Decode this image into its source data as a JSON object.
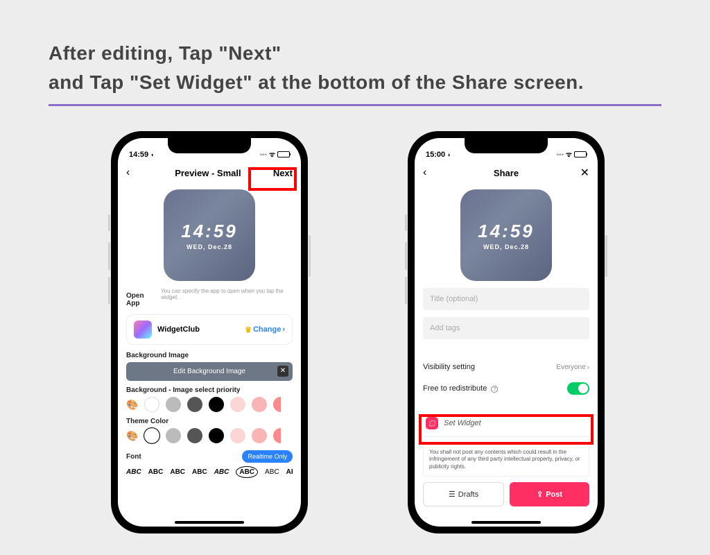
{
  "headline_l1": "After editing, Tap \"Next\"",
  "headline_l2": "and Tap \"Set Widget\" at the bottom of the Share screen.",
  "phone1": {
    "time": "14:59",
    "nav_title": "Preview - Small",
    "nav_next": "Next",
    "widget": {
      "time": "14:59",
      "date": "WED, Dec.28"
    },
    "open_app_label": "Open App",
    "open_app_hint": "You can specify the app to open when you tap the widget.",
    "app_name": "WidgetClub",
    "change_label": "Change",
    "bg_image_label": "Background Image",
    "edit_bg_label": "Edit Background Image",
    "priority_label": "Background - Image select priority",
    "theme_label": "Theme Color",
    "font_label": "Font",
    "realtime_label": "Realtime Only",
    "font_samples": [
      "ABC",
      "ABC",
      "ABC",
      "ABC",
      "ABC",
      "ABC",
      "ABC",
      "ABC"
    ]
  },
  "phone2": {
    "time": "15:00",
    "nav_title": "Share",
    "widget": {
      "time": "14:59",
      "date": "WED, Dec.28"
    },
    "title_placeholder": "Title (optional)",
    "tags_placeholder": "Add tags",
    "visibility_label": "Visibility setting",
    "visibility_value": "Everyone",
    "redistribute_label": "Free to redistribute",
    "set_widget_label": "Set Widget",
    "disclaimer": "You shall not post any contents which could result in the infringement of any third party intellectual property, privacy, or publicity rights.",
    "drafts_label": "Drafts",
    "post_label": "Post"
  }
}
